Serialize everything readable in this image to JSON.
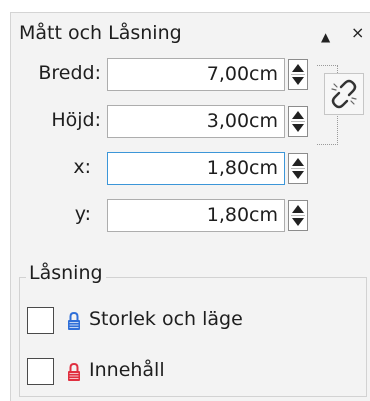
{
  "panel": {
    "title": "Mått och Låsning",
    "collapse_glyph": "▲",
    "close_glyph": "×"
  },
  "fields": [
    {
      "label": "Bredd:",
      "value": "7,00cm"
    },
    {
      "label": "Höjd:",
      "value": "3,00cm"
    },
    {
      "label": "x:",
      "value": "1,80cm"
    },
    {
      "label": "y:",
      "value": "1,80cm"
    }
  ],
  "lock_group": {
    "title": "Låsning",
    "items": [
      {
        "label": "Storlek och läge",
        "checked": false,
        "lock_color": "#2f6fd8"
      },
      {
        "label": "Innehåll",
        "checked": false,
        "lock_color": "#e03040"
      }
    ]
  }
}
